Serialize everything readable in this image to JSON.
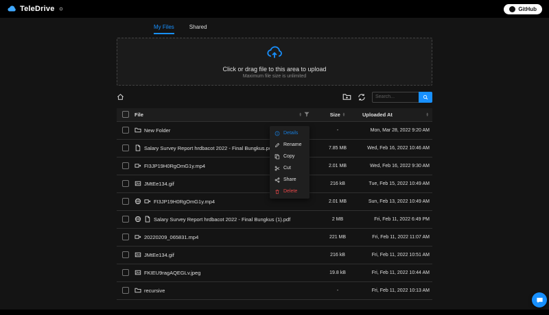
{
  "header": {
    "app_name": "TeleDrive",
    "github_label": "GitHub"
  },
  "tabs": {
    "my_files": "My Files",
    "shared": "Shared"
  },
  "upload": {
    "main_text": "Click or drag file to this area to upload",
    "sub_text": "Maximum file size is unlimited"
  },
  "toolbar": {
    "search_placeholder": "Search...",
    "icons": [
      "home-icon",
      "new-folder-icon",
      "sync-icon",
      "search-icon"
    ]
  },
  "table": {
    "col_file": "File",
    "col_size": "Size",
    "col_uploaded": "Uploaded At",
    "rows": [
      {
        "icon": "folder",
        "name": "New Folder",
        "size": "-",
        "uploaded": "Mon, Mar 28, 2022 9:20 AM"
      },
      {
        "icon": "file",
        "name": "Salary Survey Report hrdbacot 2022 - Final Bungkus.pdf",
        "size": "7.85 MB",
        "uploaded": "Wed, Feb 16, 2022 10:46 AM"
      },
      {
        "icon": "video",
        "name": "FI3JP19H0RgOmG1y.mp4",
        "size": "2.01 MB",
        "uploaded": "Wed, Feb 16, 2022 9:30 AM"
      },
      {
        "icon": "image",
        "name": "JMtEe134.gif",
        "size": "216 kB",
        "uploaded": "Tue, Feb 15, 2022 10:49 AM"
      },
      {
        "icon": "globe-video",
        "name": "FI3JP19H0RgOmG1y.mp4",
        "size": "2.01 MB",
        "uploaded": "Sun, Feb 13, 2022 10:49 AM"
      },
      {
        "icon": "globe-file",
        "name": "Salary Survey Report hrdbacot 2022 - Final Bungkus (1).pdf",
        "size": "2 MB",
        "uploaded": "Fri, Feb 11, 2022 6:49 PM"
      },
      {
        "icon": "video",
        "name": "20220209_065831.mp4",
        "size": "221 MB",
        "uploaded": "Fri, Feb 11, 2022 11:07 AM"
      },
      {
        "icon": "image",
        "name": "JMtEe134.gif",
        "size": "216 kB",
        "uploaded": "Fri, Feb 11, 2022 10:51 AM"
      },
      {
        "icon": "image",
        "name": "FKIEU9ragAQEGLv.jpeg",
        "size": "19.8 kB",
        "uploaded": "Fri, Feb 11, 2022 10:44 AM"
      },
      {
        "icon": "folder",
        "name": "recursive",
        "size": "-",
        "uploaded": "Fri, Feb 11, 2022 10:13 AM"
      }
    ]
  },
  "context_menu": {
    "items": [
      {
        "label": "Details",
        "icon": "info-circle-icon"
      },
      {
        "label": "Rename",
        "icon": "edit-icon"
      },
      {
        "label": "Copy",
        "icon": "copy-icon"
      },
      {
        "label": "Cut",
        "icon": "scissors-icon"
      },
      {
        "label": "Share",
        "icon": "share-icon"
      },
      {
        "label": "Delete",
        "icon": "trash-icon"
      }
    ]
  },
  "colors": {
    "accent": "#1890ff",
    "menu_primary": "#177ddc",
    "danger": "#e84749"
  }
}
